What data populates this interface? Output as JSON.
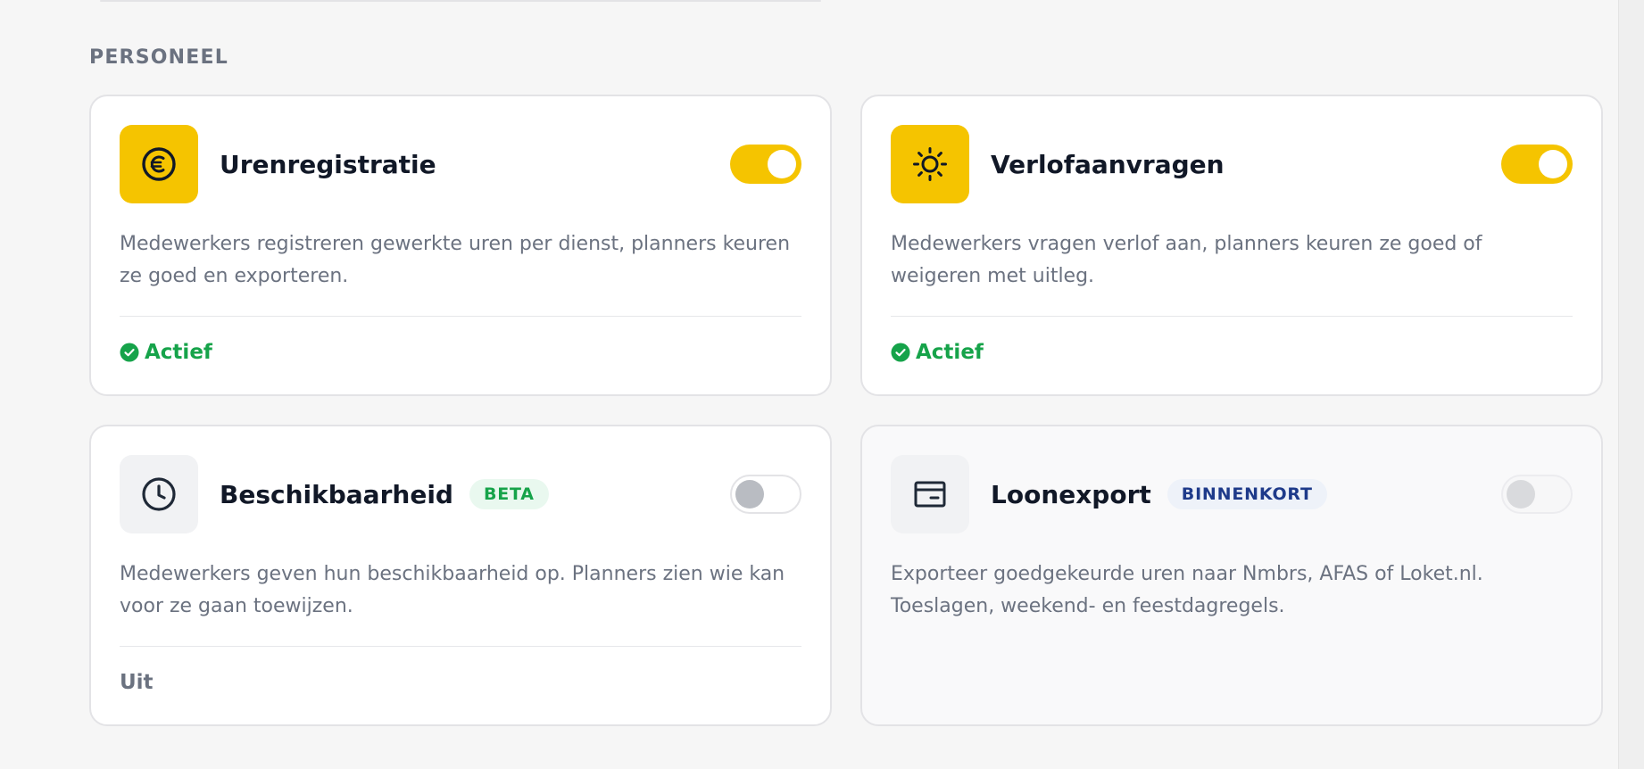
{
  "section": {
    "title": "PERSONEEL"
  },
  "modules": [
    {
      "title": "Urenregistratie",
      "icon": "euro-coin-icon",
      "enabled": true,
      "description": "Medewerkers registreren gewerkte uren per dienst, planners keuren ze goed en exporteren.",
      "status": "Actief"
    },
    {
      "title": "Verlofaanvragen",
      "icon": "sun-icon",
      "enabled": true,
      "description": "Medewerkers vragen verlof aan, planners keuren ze goed of weigeren met uitleg.",
      "status": "Actief"
    },
    {
      "title": "Beschikbaarheid",
      "badge": "BETA",
      "icon": "clock-icon",
      "enabled": false,
      "description": "Medewerkers geven hun beschikbaarheid op. Planners zien wie kan voor ze gaan toewijzen.",
      "status": "Uit"
    },
    {
      "title": "Loonexport",
      "badge": "BINNENKORT",
      "icon": "wallet-icon",
      "enabled": false,
      "description": "Exporteer goedgekeurde uren naar Nmbrs, AFAS of Loket.nl. Toeslagen, weekend- en feestdagregels."
    }
  ],
  "colors": {
    "accent": "#f5c400",
    "active_status": "#16a34a",
    "beta_badge": "#16a34a",
    "soon_badge": "#1e3a8a"
  }
}
